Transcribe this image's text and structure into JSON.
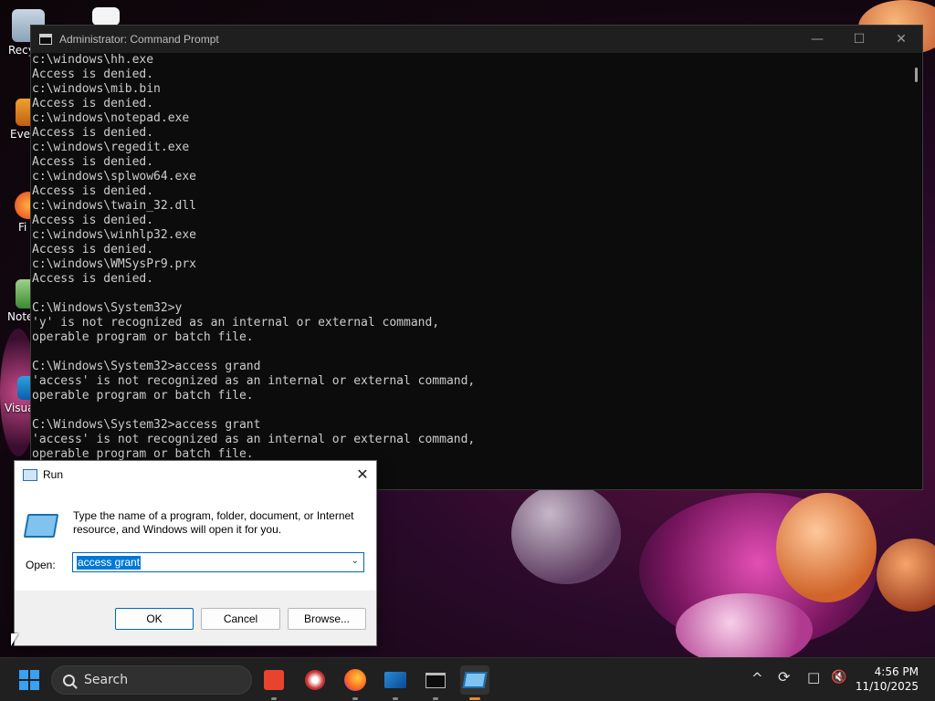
{
  "desktop": {
    "icons": [
      {
        "label": "Recyc"
      },
      {
        "label": "Ever"
      },
      {
        "label": "Fi"
      },
      {
        "label": "Note"
      },
      {
        "label": "Visua"
      }
    ]
  },
  "cmd": {
    "title": "Administrator: Command Prompt",
    "lines": [
      "c:\\windows\\hh.exe",
      "Access is denied.",
      "c:\\windows\\mib.bin",
      "Access is denied.",
      "c:\\windows\\notepad.exe",
      "Access is denied.",
      "c:\\windows\\regedit.exe",
      "Access is denied.",
      "c:\\windows\\splwow64.exe",
      "Access is denied.",
      "c:\\windows\\twain_32.dll",
      "Access is denied.",
      "c:\\windows\\winhlp32.exe",
      "Access is denied.",
      "c:\\windows\\WMSysPr9.prx",
      "Access is denied.",
      "",
      "C:\\Windows\\System32>y",
      "'y' is not recognized as an internal or external command,",
      "operable program or batch file.",
      "",
      "C:\\Windows\\System32>access grand",
      "'access' is not recognized as an internal or external command,",
      "operable program or batch file.",
      "",
      "C:\\Windows\\System32>access grant",
      "'access' is not recognized as an internal or external command,",
      "operable program or batch file."
    ],
    "minimize": "—",
    "maximize": "☐",
    "close": "✕"
  },
  "run": {
    "title": "Run",
    "description": "Type the name of a program, folder, document, or Internet resource, and Windows will open it for you.",
    "open_label": "Open:",
    "open_value": "access grant",
    "ok_label": "OK",
    "cancel_label": "Cancel",
    "browse_label": "Browse...",
    "close": "✕"
  },
  "taskbar": {
    "search_placeholder": "Search",
    "time": "4:56 PM",
    "date": "11/10/2025",
    "tray_chevron": "^"
  },
  "colors": {
    "console_bg": "#0c0c0c",
    "console_text": "#cccccc",
    "selection": "#0078d7",
    "taskbar": "#202020"
  }
}
